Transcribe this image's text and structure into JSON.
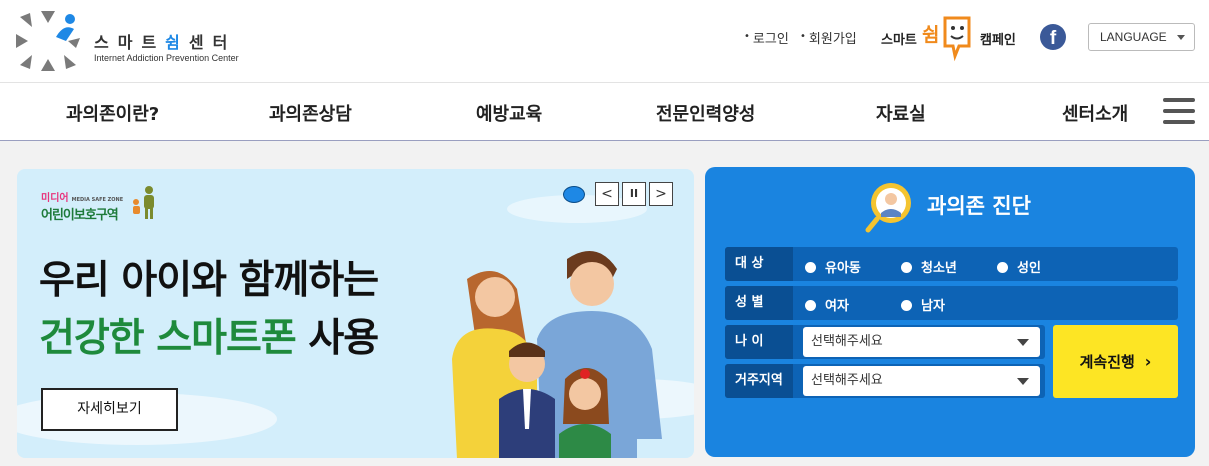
{
  "header": {
    "logo": {
      "title_pre": "스마트",
      "title_accent": "쉼",
      "title_post": "센터",
      "subtitle": "Internet Addiction Prevention Center"
    },
    "util_links": {
      "login": "로그인",
      "signup": "회원가입"
    },
    "campaign": {
      "pre": "스마트",
      "accent": "쉼",
      "post": "캠페인"
    },
    "facebook_glyph": "f",
    "language_label": "LANGUAGE"
  },
  "nav": {
    "items": [
      "과의존이란?",
      "과의존상담",
      "예방교육",
      "전문인력양성",
      "자료실",
      "센터소개"
    ]
  },
  "banner": {
    "badge_top": "미디어",
    "badge_top_small": "MEDIA SAFE ZONE",
    "badge_bottom": "어린이보호구역",
    "headline_line1": "우리 아이와 함께하는",
    "headline_line2_green": "건강한 스마트폰",
    "headline_line2_rest": " 사용",
    "detail_button": "자세히보기",
    "controls": {
      "prev": "<",
      "pause": "II",
      "next": ">"
    }
  },
  "diagnosis": {
    "title": "과의존 진단",
    "target_label": "대 상",
    "target_options": [
      "유아동",
      "청소년",
      "성인"
    ],
    "gender_label": "성 별",
    "gender_options": [
      "여자",
      "남자"
    ],
    "age_label": "나 이",
    "age_placeholder": "선택해주세요",
    "region_label": "거주지역",
    "region_placeholder": "선택해주세요",
    "continue_label": "계속진행",
    "continue_arrow": "›"
  },
  "colors": {
    "accent_blue": "#1a84e0",
    "headline_green": "#1e8a3c",
    "continue_yellow": "#fde524",
    "campaign_orange": "#f08a1c"
  }
}
